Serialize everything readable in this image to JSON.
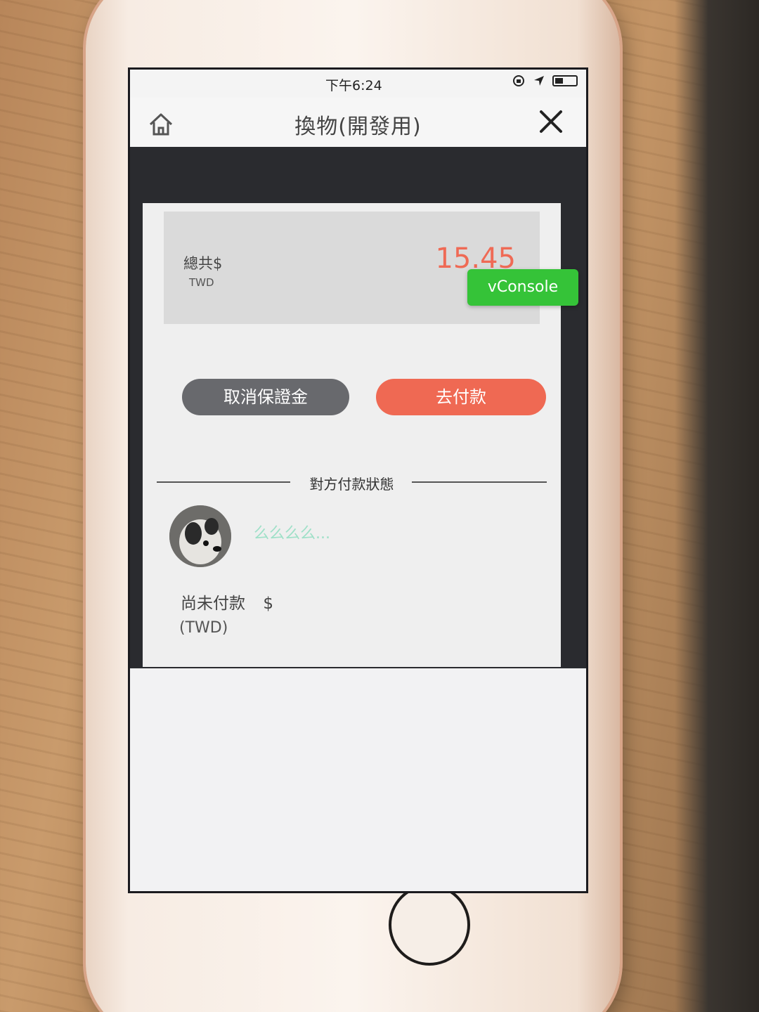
{
  "status_bar": {
    "carrier": "",
    "time": "下午6:24",
    "battery_level": 0.4
  },
  "nav": {
    "title": "換物(開發用)",
    "home_icon": "home-icon",
    "close_icon": "close-icon"
  },
  "total": {
    "label": "總共$",
    "currency": "TWD",
    "amount": "15.45"
  },
  "vconsole": {
    "label": "vConsole"
  },
  "actions": {
    "cancel_label": "取消保證金",
    "pay_label": "去付款"
  },
  "partner_section": {
    "heading": "對方付款狀態",
    "name": "么么么么...",
    "status": "尚未付款",
    "status_symbol": "$",
    "currency": "(TWD)"
  },
  "colors": {
    "accent": "#ef6953",
    "amount": "#ef6a55",
    "cancel": "#68696d",
    "vconsole": "#35c338",
    "partner_name": "#9fe0c8"
  }
}
